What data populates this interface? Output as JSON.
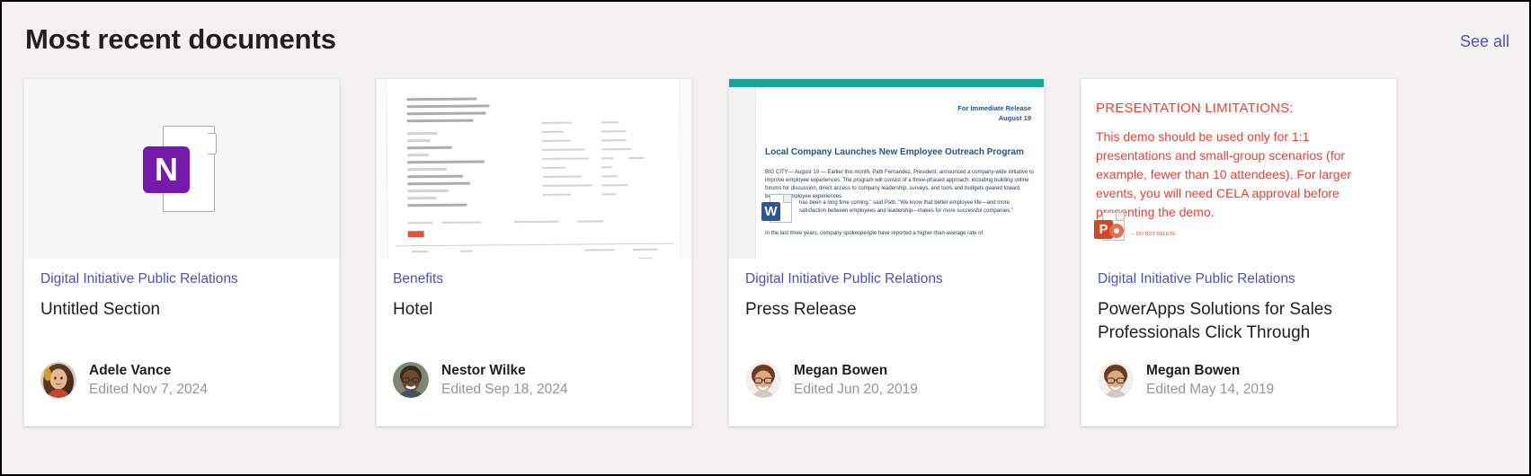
{
  "header": {
    "title": "Most recent documents",
    "see_all_label": "See all",
    "link_color": "#4b53bc"
  },
  "cards": [
    {
      "site": "Digital Initiative Public Relations",
      "title": "Untitled Section",
      "author": "Adele Vance",
      "edited": "Edited Nov 7, 2024",
      "thumbnail_kind": "onenote-icon",
      "icon_letter": "N",
      "icon_color": "#7719aa"
    },
    {
      "site": "Benefits",
      "title": "Hotel",
      "author": "Nestor Wilke",
      "edited": "Edited Sep 18, 2024",
      "thumbnail_kind": "scanned-hotel-folio",
      "scan_left_lines": [
        "CASPIT NO: 3458636",
        "VER:        PBO-012-69",
        "BUS NUM:    0116822",
        "02-12-17    15:30",
        "CARD:",
        "Amex",
        "CARD NUM:",
        "XXXX",
        "RECEIPT: 37901019",
        "TRAN TYPE:",
        "Reversed Debit",
        "Merc U 58531060",
        "TRAN CODE:",
        "Regular",
        "APRVT : 1399.00"
      ],
      "scan_right_rows": [
        [
          "Room No.:",
          "1108"
        ],
        [
          "Arrival:",
          "28.11.17"
        ],
        [
          "Departure:",
          "02.12.17"
        ],
        [
          "Confirmation No:",
          "128843208"
        ],
        [
          "Membership No.:",
          "SPG    42766"
        ],
        [
          "Cashier:",
          "116"
        ],
        [
          "Check Out Time:",
          "15:30"
        ],
        [
          "Folio Creation Date:",
          "02-DEC-17"
        ],
        [
          "Page No.:",
          "1 of 2"
        ]
      ],
      "scan_footer": [
        "TRANS: YOU / ",
        "Tel Aviv Hotel,  VAT No. 310882919   Printout Date      02.12.17"
      ],
      "scan_table_header": [
        "Date",
        "Text",
        "$4,269.00",
        "Charges",
        "USD"
      ]
    },
    {
      "site": "Digital Initiative Public Relations",
      "title": "Press Release",
      "author": "Megan Bowen",
      "edited": "Edited Jun 20, 2019",
      "thumbnail_kind": "word-press-release",
      "doc_header_lines": [
        "For Immediate Release",
        "August 19"
      ],
      "doc_headline": "Local Company Launches  New Employee Outreach Program",
      "doc_body_1": "BIG CITY— August 19 — Earlier this month, Patti Fernandez, President, announced a company-wide initiative to improve employee experiences. The program will consist of a three-phased approach, including building online forums for discussion, direct access to company leadership, surveys, and tools and budgets geared toward bettering employee experiences.",
      "doc_body_2": "has been a long time coming,\" said Patti. \"We know that better employee life—and more satisfaction between employees and leadership—makes for more successful companies.\"",
      "doc_body_3": "In the last three years, company spokespeople have reported a higher-than-average rate of",
      "badge_letter": "W",
      "badge_color": "#2b579a",
      "top_strip_color": "#18a39a"
    },
    {
      "site": "Digital Initiative Public Relations",
      "title": "PowerApps Solutions for Sales Professionals Click Through",
      "author": "Megan Bowen",
      "edited": "Edited May 14, 2019",
      "thumbnail_kind": "powerpoint-slide",
      "slide_title": "PRESENTATION LIMITATIONS:",
      "slide_body": "This demo should be used only for 1:1 presentations and small-group scenarios (for example, fewer than 10 attendees). For larger events, you will need CELA approval before presenting the demo.",
      "badge_letter": "P",
      "badge_color": "#d24726",
      "badge_note": "– DO NOT DELETE",
      "slide_text_color": "#ef4136"
    }
  ]
}
